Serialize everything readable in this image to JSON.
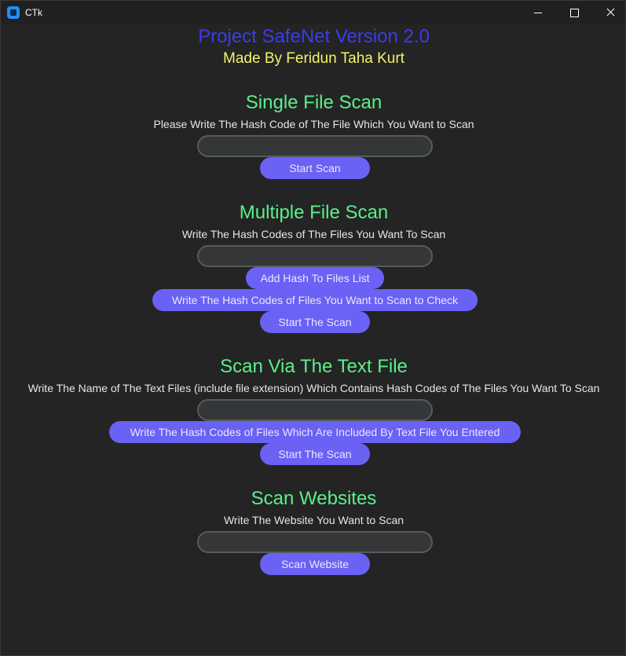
{
  "window": {
    "title": "CTk",
    "icon": "ctk-app-icon",
    "controls": [
      "minimize-icon",
      "maximize-icon",
      "close-icon"
    ]
  },
  "header": {
    "title": "Project SafeNet Version 2.0",
    "subtitle": "Made By Feridun Taha Kurt"
  },
  "single_scan": {
    "title": "Single File Scan",
    "instruction": "Please Write The Hash Code of The File Which You Want to Scan",
    "input_value": "",
    "start_label": "Start Scan"
  },
  "multiple_scan": {
    "title": "Multiple File Scan",
    "instruction": "Write The Hash Codes of The Files You Want To Scan",
    "input_value": "",
    "add_label": "Add Hash To Files List",
    "check_label": "Write The Hash Codes of Files You Want to Scan to Check",
    "start_label": "Start The Scan"
  },
  "text_file_scan": {
    "title": "Scan Via The Text File",
    "instruction": "Write The Name of The Text Files (include file extension) Which Contains Hash Codes of The Files You Want To Scan",
    "input_value": "",
    "check_label": "Write The Hash Codes of Files Which Are Included By Text File You Entered",
    "start_label": "Start The Scan"
  },
  "website_scan": {
    "title": "Scan Websites",
    "instruction": "Write The Website You Want to Scan",
    "input_value": "",
    "start_label": "Scan Website"
  },
  "colors": {
    "background": "#242424",
    "title": "#3b3bf0",
    "subtitle": "#f3f36a",
    "section_title": "#5af08a",
    "button": "#6a61f5",
    "entry_border": "#565b5e"
  }
}
